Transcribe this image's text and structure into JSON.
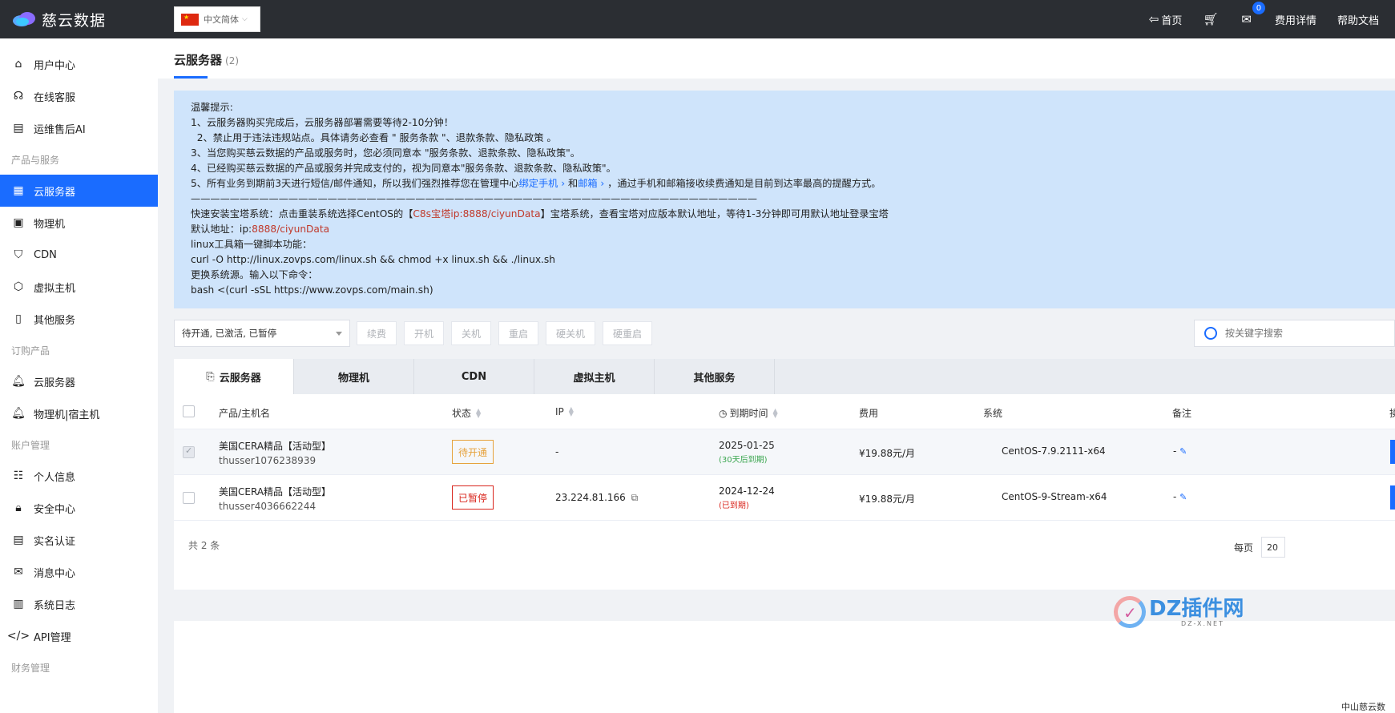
{
  "topbar": {
    "logo_text": "慈云数据",
    "language": "中文简体",
    "nav": [
      {
        "label": "首页",
        "icon": "home-icon"
      },
      {
        "label": "",
        "icon": "cart-icon"
      },
      {
        "label": "",
        "icon": "mail-icon",
        "badge": "0"
      },
      {
        "label": "费用详情",
        "icon": ""
      },
      {
        "label": "帮助文档",
        "icon": ""
      }
    ]
  },
  "sidebar": {
    "items": [
      {
        "type": "item",
        "label": "用户中心",
        "icon": "home-icon"
      },
      {
        "type": "item",
        "label": "在线客服",
        "icon": "support-icon"
      },
      {
        "type": "item",
        "label": "运维售后AI",
        "icon": "document-icon"
      },
      {
        "type": "group",
        "label": "产品与服务"
      },
      {
        "type": "item",
        "label": "云服务器",
        "icon": "grid-icon",
        "active": true
      },
      {
        "type": "item",
        "label": "物理机",
        "icon": "server-icon"
      },
      {
        "type": "item",
        "label": "CDN",
        "icon": "shield-icon"
      },
      {
        "type": "item",
        "label": "虚拟主机",
        "icon": "cube-icon"
      },
      {
        "type": "item",
        "label": "其他服务",
        "icon": "book-icon"
      },
      {
        "type": "group",
        "label": "订购产品"
      },
      {
        "type": "item",
        "label": "云服务器",
        "icon": "bell-icon"
      },
      {
        "type": "item",
        "label": "物理机|宿主机",
        "icon": "bell-icon"
      },
      {
        "type": "group",
        "label": "账户管理"
      },
      {
        "type": "item",
        "label": "个人信息",
        "icon": "id-card-icon"
      },
      {
        "type": "item",
        "label": "安全中心",
        "icon": "lock-icon"
      },
      {
        "type": "item",
        "label": "实名认证",
        "icon": "card-icon"
      },
      {
        "type": "item",
        "label": "消息中心",
        "icon": "mail-icon"
      },
      {
        "type": "item",
        "label": "系统日志",
        "icon": "log-icon"
      },
      {
        "type": "item",
        "label": "API管理",
        "icon": "code-icon"
      },
      {
        "type": "group",
        "label": "财务管理"
      }
    ]
  },
  "page": {
    "title": "云服务器",
    "count": "(2)"
  },
  "notice": {
    "heading": "温馨提示:",
    "line1": "1、云服务器购买完成后，云服务器部署需要等待2-10分钟！",
    "line2": "  2、禁止用于违法违规站点。具体请务必查看 \" 服务条款 \"、退款条款、隐私政策 。",
    "line3": "3、当您购买慈云数据的产品或服务时，您必须同意本 \"服务条款、退款条款、隐私政策\"。",
    "line4": "4、已经购买慈云数据的产品或服务并完成支付的，视为同意本\"服务条款、退款条款、隐私政策\"。",
    "line5_a": "5、所有业务到期前3天进行短信/邮件通知，所以我们强烈推荐您在管理中心",
    "line5_link1": "绑定手机 ›",
    "line5_and": " 和",
    "line5_link2": "邮箱 ›",
    "line5_b": " ，通过手机和邮箱接收续费通知是目前到达率最高的提醒方式。",
    "divider": "——————————————————————————————————————————————————————————",
    "install_a": "快速安装宝塔系统：点击重装系统选择CentOS的【",
    "install_red": "C8s宝塔ip:8888/ciyunData",
    "install_b": "】宝塔系统，查看宝塔对应版本默认地址，等待1-3分钟即可用默认地址登录宝塔",
    "default_a": "默认地址：ip:",
    "default_red": "8888/ciyunData",
    "toolbox": "linux工具箱一键脚本功能：",
    "curl": "curl -O http://linux.zovps.com/linux.sh && chmod +x linux.sh && ./linux.sh",
    "mirror": "更换系统源。输入以下命令：",
    "bash": "bash <(curl -sSL https://www.zovps.com/main.sh)"
  },
  "toolbar": {
    "filter_value": "待开通, 已激活, 已暂停",
    "buttons": [
      "续费",
      "开机",
      "关机",
      "重启",
      "硬关机",
      "硬重启"
    ],
    "search_placeholder": "按关键字搜索"
  },
  "tabs": [
    {
      "label": "云服务器",
      "active": true
    },
    {
      "label": "物理机"
    },
    {
      "label": "CDN"
    },
    {
      "label": "虚拟主机"
    },
    {
      "label": "其他服务"
    }
  ],
  "table": {
    "columns": {
      "product": "产品/主机名",
      "status": "状态",
      "ip": "IP",
      "expiry": "到期时间",
      "fee": "费用",
      "os": "系统",
      "note": "备注",
      "action": "操"
    },
    "rows": [
      {
        "name": "美国CERA精品【活动型】",
        "host": "thusser1076238939",
        "status": "待开通",
        "ip": "-",
        "expiry": "2025-01-25",
        "expiry_note": "(30天后到期)",
        "fee": "¥19.88元/月",
        "os": "CentOS-7.9.2111-x64",
        "note": "-"
      },
      {
        "name": "美国CERA精品【活动型】",
        "host": "thusser4036662244",
        "status": "已暂停",
        "ip": "23.224.81.166",
        "expiry": "2024-12-24",
        "expiry_note": "(已到期)",
        "fee": "¥19.88元/月",
        "os": "CentOS-9-Stream-x64",
        "note": "-"
      }
    ],
    "total": "共 2 条",
    "per_page_label": "每页",
    "per_page_value": "20"
  },
  "footer_fragment": "中山慈云数",
  "watermark": {
    "title": "DZ插件网",
    "sub": "DZ-X.NET"
  },
  "colors": {
    "accent": "#1a6cff",
    "topbar": "#2b2e33",
    "notice_bg": "#cfe4fb",
    "pending": "#e6a23c",
    "paused": "#d9251c"
  }
}
